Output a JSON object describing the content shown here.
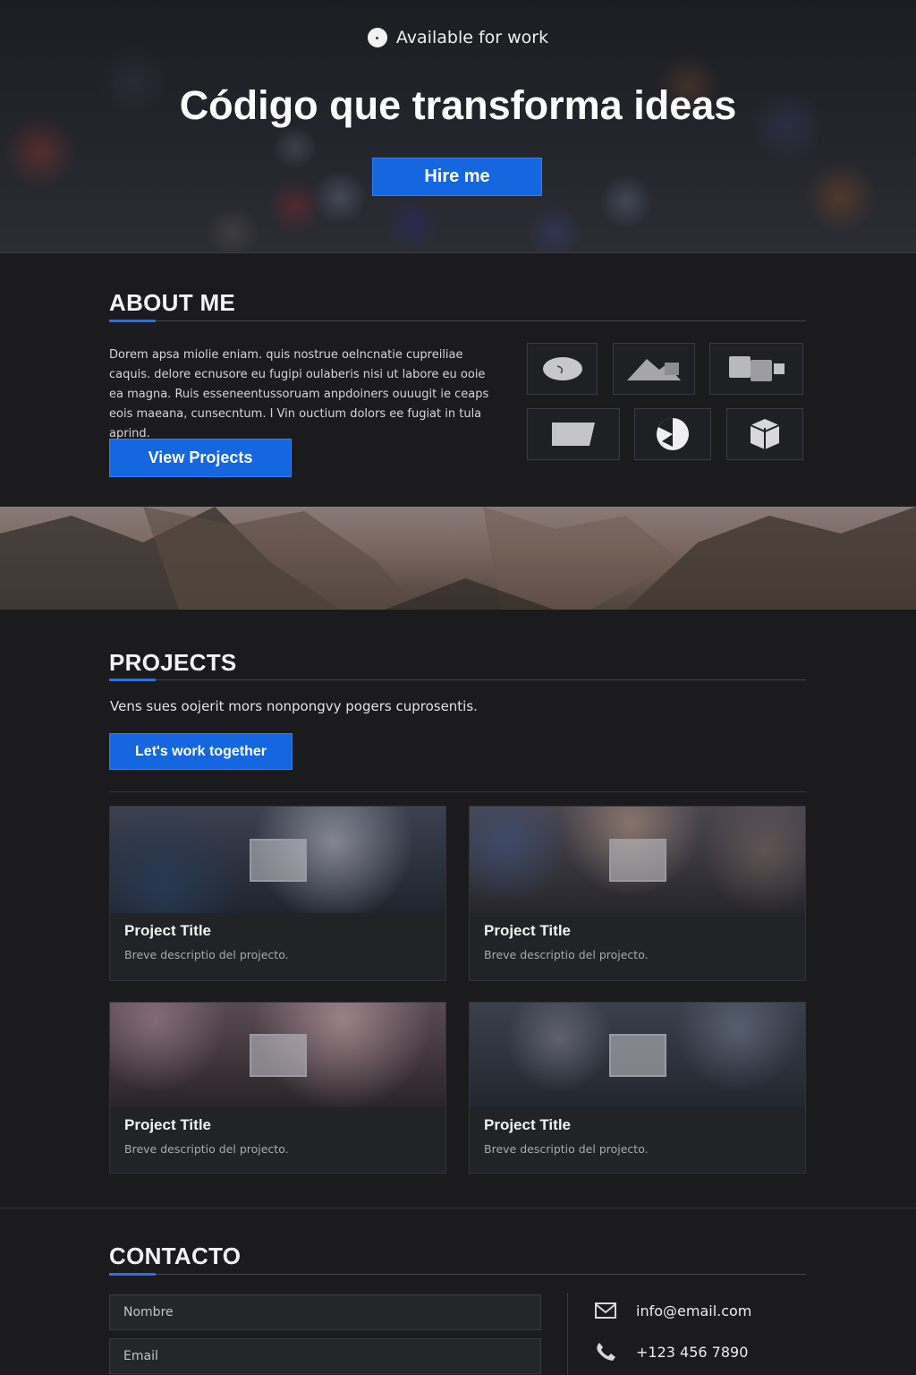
{
  "hero": {
    "availability": "Available for work",
    "title": "Código que transforma ideas",
    "cta": "Hire me"
  },
  "about": {
    "heading": "ABOUT ME",
    "body": "Dorem apsa miolie eniam. quis nostrue oelncnatie cupreiliae caquis. delore ecnusore eu fugipi oulaberis nisi ut labore eu ooie ea magna. Ruis esseneentussoruam anpdoiners ouuugit ie ceaps eois maeana, cunsecntum. I Vin ouctium dolors ee fugiat in tula aprind.",
    "button": "View Projects",
    "skills": [
      "oval-icon",
      "mountain-icon",
      "blocks-icon",
      "card-icon",
      "pie-icon",
      "box-icon"
    ]
  },
  "projects": {
    "heading": "PROJECTS",
    "description": "Vens sues oojerit mors nonpongvy pogers cuprosentis.",
    "button": "Let's work together",
    "cards": [
      {
        "title": "Project Title",
        "description": "Breve descriptio del projecto."
      },
      {
        "title": "Project Title",
        "description": "Breve descriptio del projecto."
      },
      {
        "title": "Project Title",
        "description": "Breve descriptio del projecto."
      },
      {
        "title": "Project Title",
        "description": "Breve descriptio del projecto."
      }
    ]
  },
  "contact": {
    "heading": "CONTACTO",
    "name_placeholder": "Nombre",
    "email_placeholder": "Email",
    "email": "info@email.com",
    "phone": "+123 456 7890"
  },
  "colors": {
    "background": "#1b1b1e",
    "accent": "#1567e0",
    "card": "#222327"
  }
}
